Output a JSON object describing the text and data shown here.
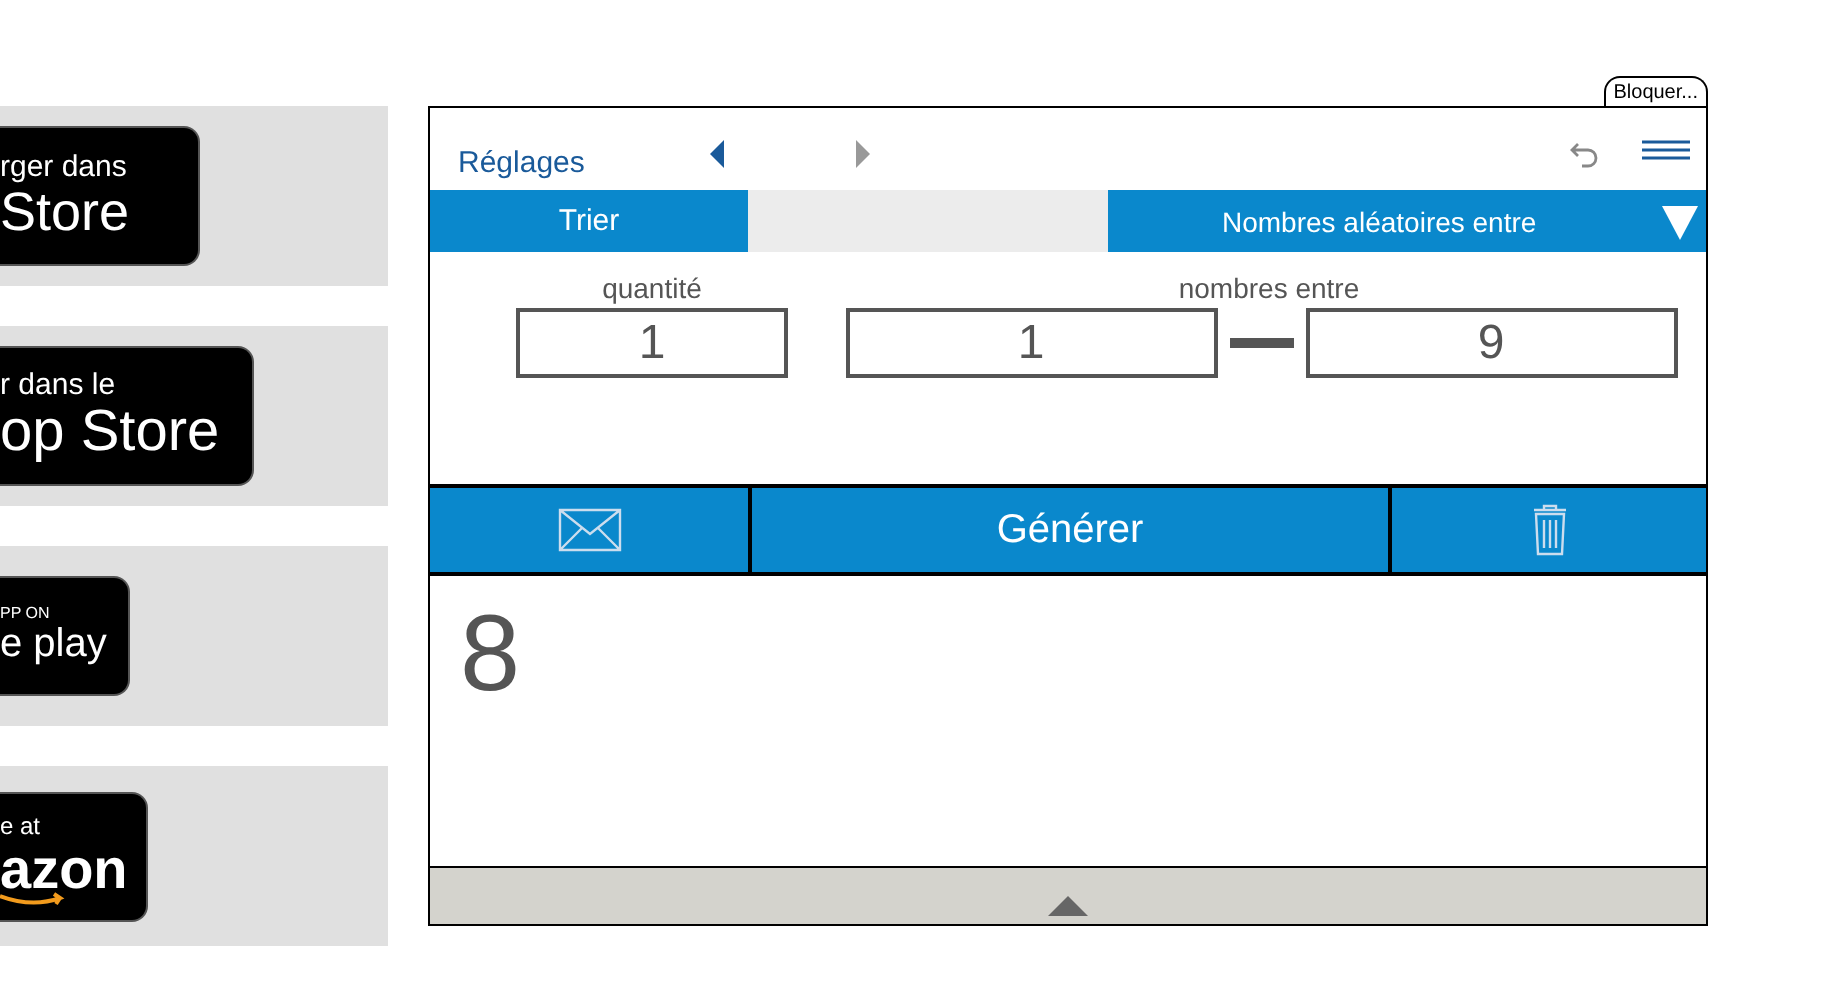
{
  "store_badges": [
    {
      "line1": "rger dans",
      "line2": "Store",
      "kind": "apple"
    },
    {
      "line1": "r dans le",
      "line2": "op Store",
      "kind": "apple"
    },
    {
      "line1": "PP ON",
      "line2": "e play",
      "kind": "google"
    },
    {
      "line1": "e at",
      "line2": "azon",
      "kind": "amazon"
    }
  ],
  "lock_button": "Bloquer...",
  "header": {
    "title": "Réglages",
    "prev_disabled": false,
    "next_disabled": true
  },
  "toolbar": {
    "sort_button": "Trier",
    "mode_dropdown": "Nombres aléatoires entre"
  },
  "form": {
    "quantity_label": "quantité",
    "quantity": "1",
    "range_label": "nombres entre",
    "range_from": "1",
    "range_to": "9"
  },
  "actions": {
    "generate_button": "Générer"
  },
  "results": [
    "8"
  ]
}
